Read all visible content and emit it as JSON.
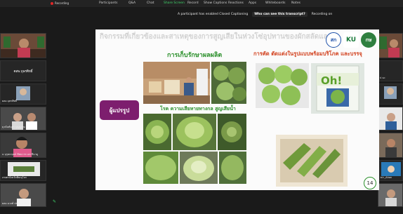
{
  "toolbar": {
    "recording_label": "Recording",
    "buttons": [
      "Participants",
      "Q&A",
      "Chat",
      "Share Screen",
      "Record",
      "Show Captions",
      "Reactions",
      "Apps",
      "Whiteboards",
      "Notes"
    ]
  },
  "caption_notice": {
    "message": "A participant has enabled Closed Captioning",
    "prompt": "Who can see this transcript?",
    "recording_on": "Recording on"
  },
  "left_gallery": [
    {
      "label": "",
      "name": ""
    },
    {
      "label": "",
      "name": "ฅสพ.บุษรศิทธิ์"
    },
    {
      "label": "ผลอ.บุษรศิทธิ์",
      "name": ""
    },
    {
      "label": "ยุวนันท์บุตร บุญญาณ",
      "name": ""
    },
    {
      "label": "ฉ บุรุษกฤษณ์ ทิพยวาท ฉพ ขีนาดู",
      "name": ""
    },
    {
      "label": "เกษตรจังหวัดพิษณุโลก",
      "name": ""
    },
    {
      "label": "ผลอ.นวงศ์ ประทักษาโยนะ",
      "name": ""
    }
  ],
  "right_gallery": [
    {
      "label": "ป ฉะ",
      "name": ""
    },
    {
      "label": "วปา_Ahon",
      "name": ""
    },
    {
      "label": "",
      "name": ""
    },
    {
      "label": "",
      "name": ""
    },
    {
      "label": "",
      "name": ""
    }
  ],
  "slide": {
    "title": "กิจกรรมที่เกี่ยวข้องและสาเหตุของการสูญเสียในห่วงโซ่อุปทานของผักสลัดและผักกาดหอม",
    "logos": [
      "สก",
      "KU",
      "กษ"
    ],
    "left_heading": "การเก็บรักษาผลผลิต",
    "mid_heading": "โรค ความเสียหายทางกล สูญเสียน้ำ",
    "right_heading": "การคัด ตัดแต่งในรูปแบบพร้อมบริโภค และบรรจุ",
    "actor": "ผู้แปรรูป",
    "page_number": "14",
    "package_text": "Oh!"
  },
  "colors": {
    "accent_green": "#2a8f2a",
    "accent_red": "#d2421f",
    "actor_purple": "#7d1e6e",
    "share_green": "#3fd46a"
  }
}
